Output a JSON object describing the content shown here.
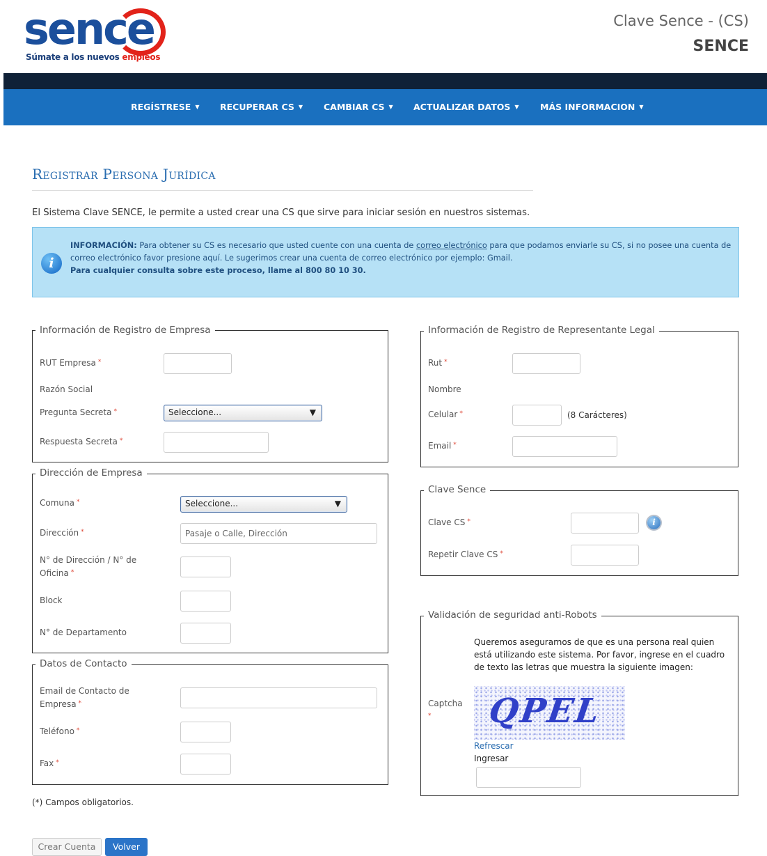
{
  "header": {
    "logo_word": "sence",
    "logo_tagline_a": "Súmate a los nuevos ",
    "logo_tagline_b": "empleos",
    "title": "Clave Sence - (CS)",
    "subtitle": "SENCE"
  },
  "nav": {
    "items": [
      {
        "label": "REGÍSTRESE"
      },
      {
        "label": "RECUPERAR CS"
      },
      {
        "label": "CAMBIAR CS"
      },
      {
        "label": "ACTUALIZAR DATOS"
      },
      {
        "label": "MÁS INFORMACION"
      }
    ]
  },
  "page": {
    "title": "Registrar Persona Jurídica",
    "intro": "El Sistema Clave SENCE, le permite a usted crear una CS que sirve para iniciar sesión en nuestros sistemas."
  },
  "info": {
    "label": "INFORMACIÓN:",
    "text1": " Para obtener su CS es necesario que usted cuente con una cuenta de ",
    "link1": "correo electrónico",
    "text2": " para que podamos enviarle su CS, si no posee una cuenta de correo electrónico favor presione ",
    "link2": "aquí",
    "text3": ". Le sugerimos crear una cuenta de correo electrónico por ejemplo: ",
    "link3": "Gmail",
    "text4": ".",
    "line3": "Para cualquier consulta sobre este proceso, llame al 800 80 10 30."
  },
  "empresa": {
    "legend": "Información de Registro de Empresa",
    "rut_label": "RUT Empresa",
    "razon_label": "Razón Social",
    "pregunta_label": "Pregunta Secreta",
    "pregunta_value": "Seleccione...",
    "respuesta_label": "Respuesta Secreta"
  },
  "direccion": {
    "legend": "Dirección de Empresa",
    "comuna_label": "Comuna",
    "comuna_value": "Seleccione...",
    "direccion_label": "Dirección",
    "direccion_placeholder": "Pasaje o Calle, Dirección",
    "numero_label": "N° de Dirección / N° de Oficina",
    "block_label": "Block",
    "depto_label": "N° de Departamento"
  },
  "contacto": {
    "legend": "Datos de Contacto",
    "email_label": "Email de Contacto de Empresa",
    "telefono_label": "Teléfono",
    "fax_label": "Fax"
  },
  "required_note": "(*) Campos obligatorios.",
  "required_mark": "*",
  "representante": {
    "legend": "Información de Registro de Representante Legal",
    "rut_label": "Rut",
    "nombre_label": "Nombre",
    "celular_label": "Celular",
    "celular_hint": "(8 Carácteres)",
    "email_label": "Email"
  },
  "clave": {
    "legend": "Clave Sence",
    "clave_label": "Clave CS",
    "repetir_label": "Repetir Clave CS",
    "help_icon": "info-icon"
  },
  "captcha": {
    "legend": "Validación de seguridad anti-Robots",
    "description": "Queremos asegurarnos de que es una persona real quien está utilizando este sistema. Por favor, ingrese en el cuadro de texto las letras que muestra la siguiente imagen:",
    "label": "Captcha",
    "image_text": "QPEL",
    "refresh": "Refrescar",
    "ingresar": "Ingresar"
  },
  "buttons": {
    "crear": "Crear Cuenta",
    "volver": "Volver"
  },
  "colors": {
    "navbar": "#1a70bf",
    "darkbar": "#0f2137",
    "title": "#2a6db0",
    "infobox": "#b6e1f6",
    "logo_blue": "#1b4f9c",
    "logo_red": "#e2231a"
  }
}
